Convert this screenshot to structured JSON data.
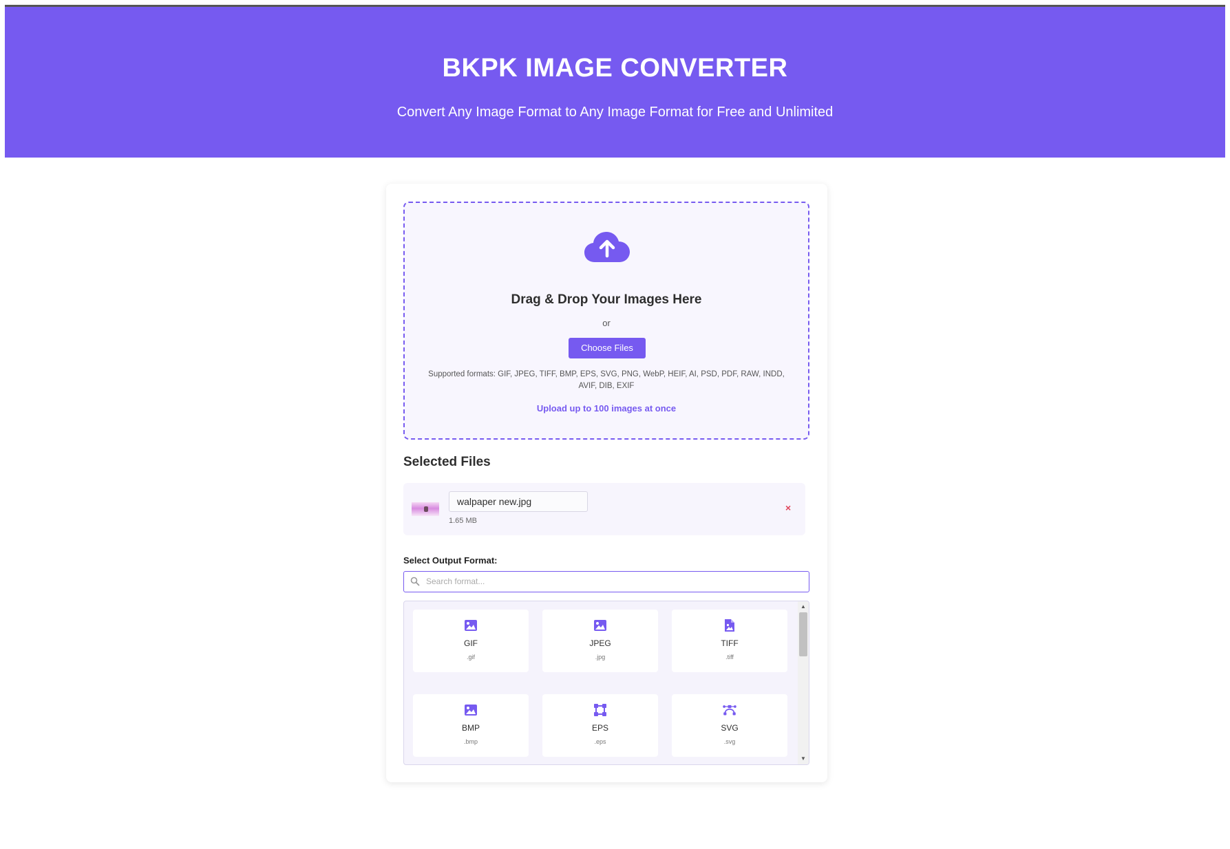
{
  "header": {
    "title": "BKPK IMAGE CONVERTER",
    "subtitle": "Convert Any Image Format to Any Image Format for Free and Unlimited",
    "bg_color": "#765af0"
  },
  "dropzone": {
    "icon": "cloud-upload-icon",
    "title": "Drag & Drop Your Images Here",
    "or_text": "or",
    "button_label": "Choose Files",
    "supported_formats": "Supported formats: GIF, JPEG, TIFF, BMP, EPS, SVG, PNG, WebP, HEIF, AI, PSD, PDF, RAW, INDD, AVIF, DIB, EXIF",
    "limit_text": "Upload up to 100 images at once"
  },
  "selected_files": {
    "title": "Selected Files",
    "files": [
      {
        "name": "walpaper new.jpg",
        "size": "1.65 MB",
        "remove_label": "×"
      }
    ]
  },
  "output_format": {
    "label": "Select Output Format:",
    "search_placeholder": "Search format...",
    "search_value": "",
    "formats": [
      {
        "name": "GIF",
        "ext": ".gif",
        "icon": "image-icon"
      },
      {
        "name": "JPEG",
        "ext": ".jpg",
        "icon": "image-icon"
      },
      {
        "name": "TIFF",
        "ext": ".tiff",
        "icon": "file-image-icon"
      },
      {
        "name": "BMP",
        "ext": ".bmp",
        "icon": "image-icon"
      },
      {
        "name": "EPS",
        "ext": ".eps",
        "icon": "vector-square-icon"
      },
      {
        "name": "SVG",
        "ext": ".svg",
        "icon": "bezier-curve-icon"
      }
    ]
  },
  "colors": {
    "accent": "#765af0",
    "remove": "#e0455b"
  }
}
